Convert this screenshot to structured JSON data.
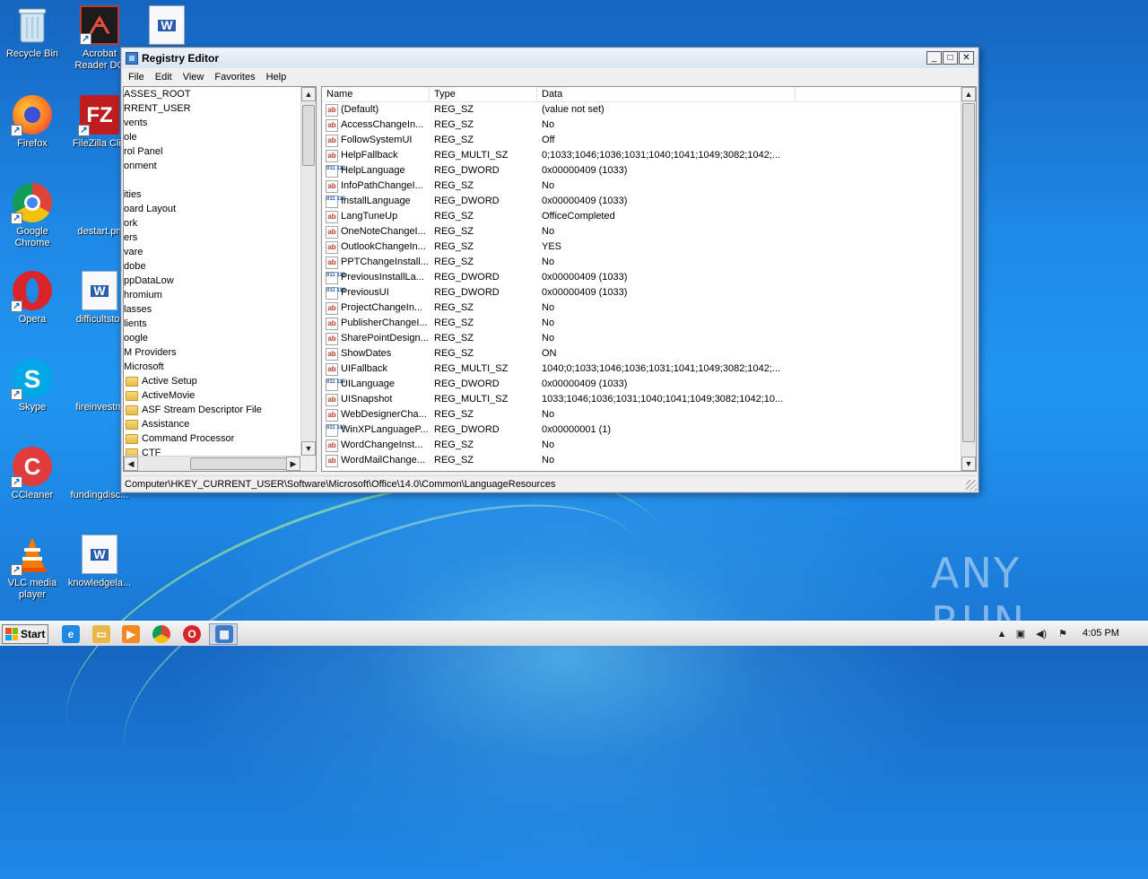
{
  "desktop": {
    "icons": [
      {
        "label": "Recycle Bin",
        "label2": ""
      },
      {
        "label": "Acrobat",
        "label2": "Reader DC"
      },
      {
        "label": "",
        "label2": ""
      },
      {
        "label": "Firefox",
        "label2": ""
      },
      {
        "label": "FileZilla Clie",
        "label2": ""
      },
      {
        "label": "Google",
        "label2": "Chrome"
      },
      {
        "label": "destart.pn",
        "label2": ""
      },
      {
        "label": "Opera",
        "label2": ""
      },
      {
        "label": "difficultstor",
        "label2": ""
      },
      {
        "label": "Skype",
        "label2": ""
      },
      {
        "label": "fireinvestm",
        "label2": ""
      },
      {
        "label": "CCleaner",
        "label2": ""
      },
      {
        "label": "fundingdisc...",
        "label2": ""
      },
      {
        "label": "VLC media",
        "label2": "player"
      },
      {
        "label": "knowledgela...",
        "label2": ""
      }
    ],
    "watermark": "ANY RUN"
  },
  "window": {
    "title": "Registry Editor",
    "buttons": {
      "minimize": "_",
      "maximize": "□",
      "close": "✕"
    },
    "menu": [
      "File",
      "Edit",
      "View",
      "Favorites",
      "Help"
    ],
    "tree": [
      {
        "label": "ASSES_ROOT",
        "folder": false
      },
      {
        "label": "RRENT_USER",
        "folder": false
      },
      {
        "label": "vents",
        "folder": false
      },
      {
        "label": "ole",
        "folder": false
      },
      {
        "label": "rol Panel",
        "folder": false
      },
      {
        "label": "onment",
        "folder": false
      },
      {
        "label": "",
        "folder": false
      },
      {
        "label": "ities",
        "folder": false
      },
      {
        "label": "oard Layout",
        "folder": false
      },
      {
        "label": "ork",
        "folder": false
      },
      {
        "label": "ers",
        "folder": false
      },
      {
        "label": "vare",
        "folder": false
      },
      {
        "label": "dobe",
        "folder": false
      },
      {
        "label": "ppDataLow",
        "folder": false
      },
      {
        "label": "hromium",
        "folder": false
      },
      {
        "label": "lasses",
        "folder": false
      },
      {
        "label": "lients",
        "folder": false
      },
      {
        "label": "oogle",
        "folder": false
      },
      {
        "label": "M Providers",
        "folder": false
      },
      {
        "label": "Microsoft",
        "folder": false
      },
      {
        "label": "Active Setup",
        "folder": true
      },
      {
        "label": "ActiveMovie",
        "folder": true
      },
      {
        "label": "ASF Stream Descriptor File",
        "folder": true
      },
      {
        "label": "Assistance",
        "folder": true
      },
      {
        "label": "Command Processor",
        "folder": true
      },
      {
        "label": "CTF",
        "folder": true
      }
    ],
    "columns": {
      "name": "Name",
      "type": "Type",
      "data": "Data"
    },
    "values": [
      {
        "name": "(Default)",
        "type": "REG_SZ",
        "data": "(value not set)",
        "icon": "ab"
      },
      {
        "name": "AccessChangeIn...",
        "type": "REG_SZ",
        "data": "No",
        "icon": "ab"
      },
      {
        "name": "FollowSystemUI",
        "type": "REG_SZ",
        "data": "Off",
        "icon": "ab"
      },
      {
        "name": "HelpFallback",
        "type": "REG_MULTI_SZ",
        "data": "0;1033;1046;1036;1031;1040;1041;1049;3082;1042;...",
        "icon": "ab"
      },
      {
        "name": "HelpLanguage",
        "type": "REG_DWORD",
        "data": "0x00000409 (1033)",
        "icon": "bin"
      },
      {
        "name": "InfoPathChangeI...",
        "type": "REG_SZ",
        "data": "No",
        "icon": "ab"
      },
      {
        "name": "InstallLanguage",
        "type": "REG_DWORD",
        "data": "0x00000409 (1033)",
        "icon": "bin"
      },
      {
        "name": "LangTuneUp",
        "type": "REG_SZ",
        "data": "OfficeCompleted",
        "icon": "ab"
      },
      {
        "name": "OneNoteChangeI...",
        "type": "REG_SZ",
        "data": "No",
        "icon": "ab"
      },
      {
        "name": "OutlookChangeIn...",
        "type": "REG_SZ",
        "data": "YES",
        "icon": "ab"
      },
      {
        "name": "PPTChangeInstall...",
        "type": "REG_SZ",
        "data": "No",
        "icon": "ab"
      },
      {
        "name": "PreviousInstallLa...",
        "type": "REG_DWORD",
        "data": "0x00000409 (1033)",
        "icon": "bin"
      },
      {
        "name": "PreviousUI",
        "type": "REG_DWORD",
        "data": "0x00000409 (1033)",
        "icon": "bin"
      },
      {
        "name": "ProjectChangeIn...",
        "type": "REG_SZ",
        "data": "No",
        "icon": "ab"
      },
      {
        "name": "PublisherChangeI...",
        "type": "REG_SZ",
        "data": "No",
        "icon": "ab"
      },
      {
        "name": "SharePointDesign...",
        "type": "REG_SZ",
        "data": "No",
        "icon": "ab"
      },
      {
        "name": "ShowDates",
        "type": "REG_SZ",
        "data": "ON",
        "icon": "ab"
      },
      {
        "name": "UIFallback",
        "type": "REG_MULTI_SZ",
        "data": "1040;0;1033;1046;1036;1031;1041;1049;3082;1042;...",
        "icon": "ab"
      },
      {
        "name": "UILanguage",
        "type": "REG_DWORD",
        "data": "0x00000409 (1033)",
        "icon": "bin"
      },
      {
        "name": "UISnapshot",
        "type": "REG_MULTI_SZ",
        "data": "1033;1046;1036;1031;1040;1041;1049;3082;1042;10...",
        "icon": "ab"
      },
      {
        "name": "WebDesignerCha...",
        "type": "REG_SZ",
        "data": "No",
        "icon": "ab"
      },
      {
        "name": "WinXPLanguageP...",
        "type": "REG_DWORD",
        "data": "0x00000001 (1)",
        "icon": "bin"
      },
      {
        "name": "WordChangeInst...",
        "type": "REG_SZ",
        "data": "No",
        "icon": "ab"
      },
      {
        "name": "WordMailChange...",
        "type": "REG_SZ",
        "data": "No",
        "icon": "ab"
      }
    ],
    "status_path": "Computer\\HKEY_CURRENT_USER\\Software\\Microsoft\\Office\\14.0\\Common\\LanguageResources"
  },
  "taskbar": {
    "start_label": "Start",
    "clock": "4:05 PM",
    "pinned": [
      "internet-explorer-icon",
      "explorer-icon",
      "media-player-icon",
      "chrome-icon",
      "opera-icon",
      "regedit-icon"
    ]
  }
}
